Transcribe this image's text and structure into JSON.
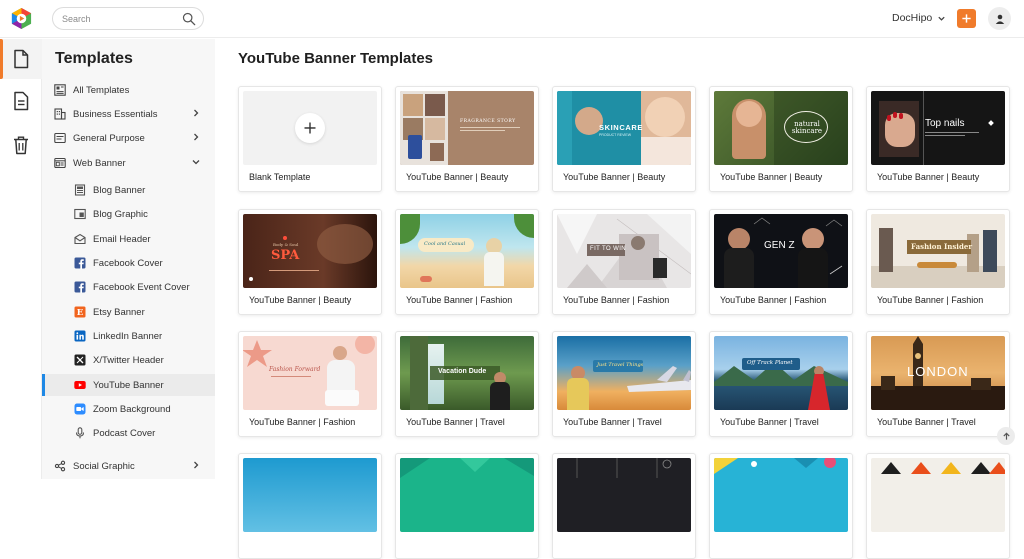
{
  "header": {
    "search_placeholder": "Search",
    "workspace": "DocHipo"
  },
  "sidebar": {
    "title": "Templates",
    "items": [
      {
        "label": "All Templates",
        "icon": "all-templates-icon"
      },
      {
        "label": "Business Essentials",
        "icon": "building-icon"
      },
      {
        "label": "General Purpose",
        "icon": "general-purpose-icon"
      },
      {
        "label": "Web Banner",
        "icon": "web-banner-icon"
      },
      {
        "label": "Social Graphic",
        "icon": "social-graphic-icon"
      }
    ],
    "subitems": [
      {
        "label": "Blog Banner",
        "icon": "blog-banner-icon"
      },
      {
        "label": "Blog Graphic",
        "icon": "blog-graphic-icon"
      },
      {
        "label": "Email Header",
        "icon": "email-icon"
      },
      {
        "label": "Facebook Cover",
        "icon": "facebook-icon"
      },
      {
        "label": "Facebook Event Cover",
        "icon": "facebook-icon"
      },
      {
        "label": "Etsy Banner",
        "icon": "etsy-icon"
      },
      {
        "label": "LinkedIn Banner",
        "icon": "linkedin-icon"
      },
      {
        "label": "X/Twitter Header",
        "icon": "x-icon"
      },
      {
        "label": "YouTube Banner",
        "icon": "youtube-icon"
      },
      {
        "label": "Zoom Background",
        "icon": "zoom-icon"
      },
      {
        "label": "Podcast Cover",
        "icon": "microphone-icon"
      }
    ]
  },
  "main": {
    "title": "YouTube Banner Templates",
    "cards": [
      {
        "label": "Blank Template"
      },
      {
        "label": "YouTube Banner | Beauty",
        "text": "FRAGRANCE STORY"
      },
      {
        "label": "YouTube Banner | Beauty",
        "text": "SKINCARE",
        "text2": "PRODUCT REVIEW"
      },
      {
        "label": "YouTube Banner | Beauty",
        "text": "natural skincare"
      },
      {
        "label": "YouTube Banner | Beauty",
        "text": "Top nails"
      },
      {
        "label": "YouTube Banner | Beauty",
        "text": "SPA",
        "text2": "Body & Soul"
      },
      {
        "label": "YouTube Banner | Fashion",
        "text": "Cool and Casual"
      },
      {
        "label": "YouTube Banner | Fashion",
        "text": "FIT TO WIN"
      },
      {
        "label": "YouTube Banner | Fashion",
        "text": "GEN Z"
      },
      {
        "label": "YouTube Banner | Fashion",
        "text": "Fashion Insider"
      },
      {
        "label": "YouTube Banner | Fashion",
        "text": "Fashion Forward"
      },
      {
        "label": "YouTube Banner | Travel",
        "text": "Vacation Dude"
      },
      {
        "label": "YouTube Banner | Travel",
        "text": "Just Travel Things"
      },
      {
        "label": "YouTube Banner | Travel",
        "text": "Off Track Planet"
      },
      {
        "label": "YouTube Banner | Travel",
        "text": "LONDON"
      }
    ]
  },
  "colors": {
    "accent": "#f07b2b",
    "active_indicator": "#1e88e5"
  }
}
